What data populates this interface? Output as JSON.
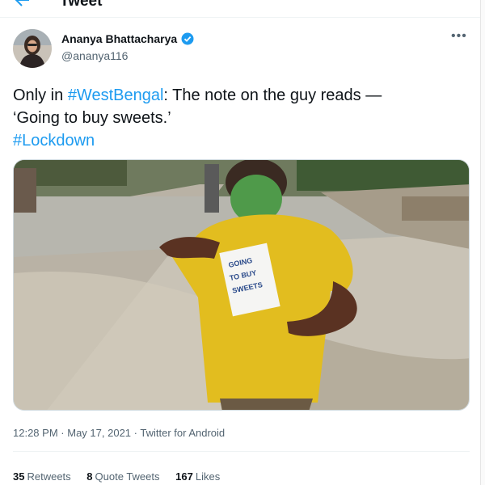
{
  "header": {
    "title": "Tweet",
    "back_icon": "arrow-left-icon"
  },
  "tweet": {
    "author": {
      "name": "Ananya Bhattacharya",
      "handle": "@ananya116",
      "verified": true,
      "verified_icon": "verified-badge-icon"
    },
    "more_icon": "more-horizontal-icon",
    "text": {
      "prefix": "Only in ",
      "hashtag1": "#WestBengal",
      "middle": ": The note on the guy reads —",
      "line2": "‘Going to buy sweets.’",
      "hashtag2": "#Lockdown"
    },
    "note_text": [
      "GOING",
      "TO BUY",
      "SWEETS"
    ],
    "time": "12:28 PM",
    "date": "May 17, 2021",
    "source": "Twitter for Android",
    "sep": "·",
    "stats": {
      "retweets_count": "35",
      "retweets_label": "Retweets",
      "quotes_count": "8",
      "quotes_label": "Quote Tweets",
      "likes_count": "167",
      "likes_label": "Likes"
    }
  },
  "colors": {
    "accent": "#1d9bf0",
    "text": "#0f1419",
    "secondary": "#536471"
  }
}
